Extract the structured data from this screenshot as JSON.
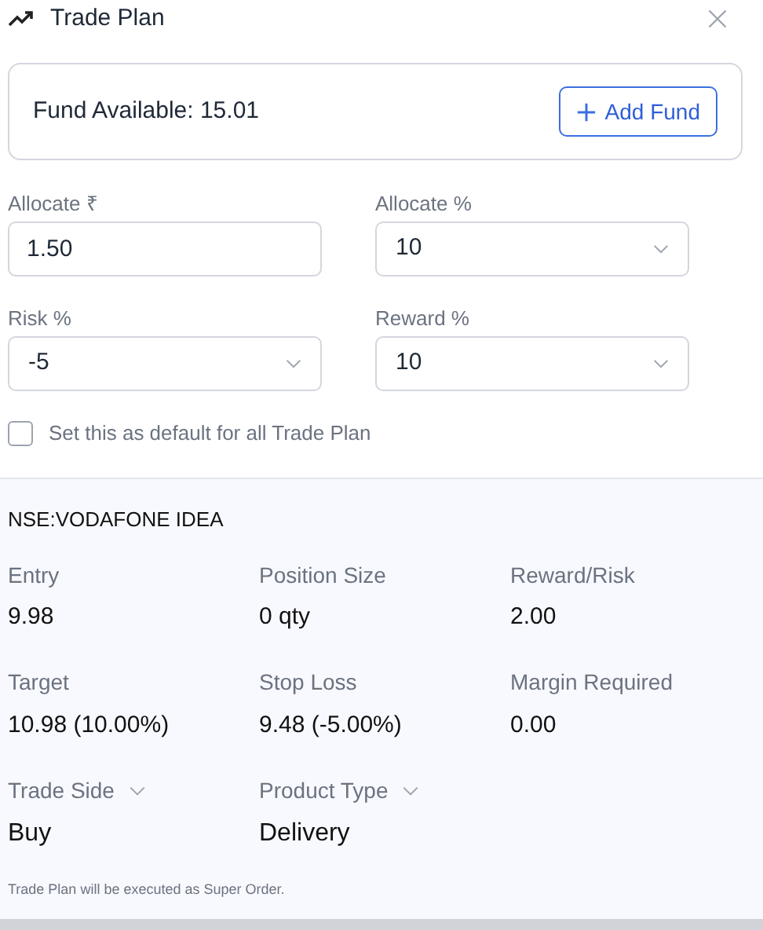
{
  "header": {
    "title": "Trade Plan"
  },
  "fund": {
    "label": "Fund Available: 15.01",
    "button": "Add Fund"
  },
  "fields": [
    {
      "kind": "input",
      "label": "Allocate ₹",
      "value": "1.50"
    },
    {
      "kind": "select",
      "label": "Allocate %",
      "value": "10"
    },
    {
      "kind": "select",
      "label": "Risk %",
      "value": "-5"
    },
    {
      "kind": "select",
      "label": "Reward %",
      "value": "10"
    }
  ],
  "default_option": {
    "label": "Set this as default for all Trade Plan",
    "checked": false
  },
  "summary": {
    "symbol": "NSE:VODAFONE IDEA",
    "items": [
      {
        "kind": "stat",
        "label": "Entry",
        "value": "9.98"
      },
      {
        "kind": "stat",
        "label": "Position Size",
        "value": "0 qty"
      },
      {
        "kind": "stat",
        "label": "Reward/Risk",
        "value": "2.00"
      },
      {
        "kind": "stat",
        "label": "Target",
        "value": "10.98 (10.00%)"
      },
      {
        "kind": "stat",
        "label": "Stop Loss",
        "value": "9.48 (-5.00%)"
      },
      {
        "kind": "stat",
        "label": "Margin Required",
        "value": "0.00"
      },
      {
        "kind": "dropdown",
        "label": "Trade Side",
        "value": "Buy"
      },
      {
        "kind": "dropdown",
        "label": "Product Type",
        "value": "Delivery"
      }
    ],
    "note": "Trade Plan will be executed as Super Order."
  }
}
